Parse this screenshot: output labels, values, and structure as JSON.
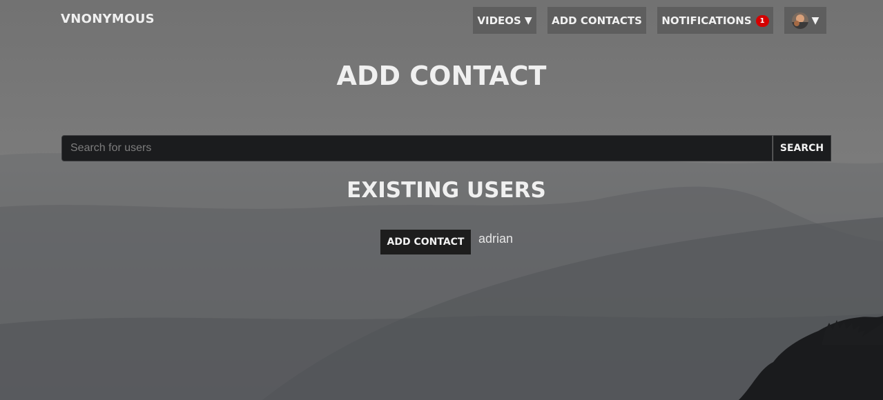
{
  "brand": "VNONYMOUS",
  "nav": {
    "videos_label": "VIDEOS",
    "videos_caret": "▼",
    "add_contacts_label": "ADD CONTACTS",
    "notifications_label": "NOTIFICATIONS",
    "notifications_count": "1",
    "user_caret": "▼"
  },
  "page_title": "ADD CONTACT",
  "search": {
    "placeholder": "Search for users",
    "value": "",
    "button_label": "SEARCH"
  },
  "existing_users": {
    "title": "EXISTING USERS",
    "users": [
      {
        "name": "adrian",
        "action_label": "ADD CONTACT"
      }
    ]
  },
  "colors": {
    "nav_button_bg": "#5e5e5e",
    "badge_bg": "#d40000",
    "dark_control_bg": "#1b1c1e"
  },
  "icons": {
    "videos_dropdown": "caret-down-icon",
    "user_dropdown": "caret-down-icon",
    "user_avatar": "avatar"
  }
}
